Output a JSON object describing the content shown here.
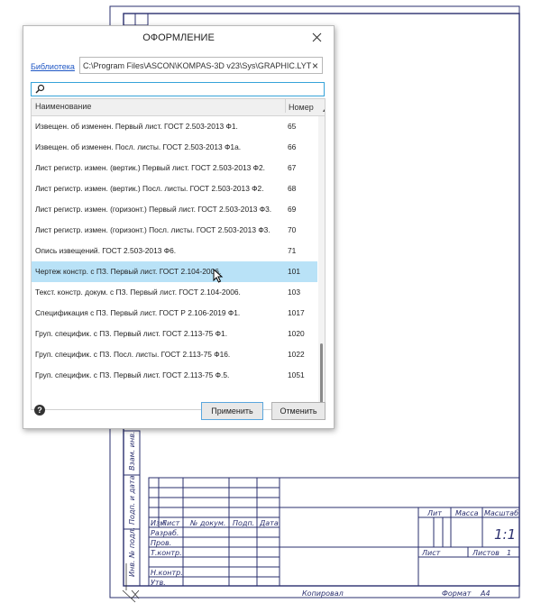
{
  "dialog": {
    "title": "ОФОРМЛЕНИЕ",
    "library_label": "Библиотека",
    "library_path": "C:\\Program Files\\ASCON\\KOMPAS-3D v23\\Sys\\GRAPHIC.LYT",
    "search_value": "",
    "columns": {
      "name": "Наименование",
      "number": "Номер"
    },
    "rows": [
      {
        "name": "Извещен. об изменен. Первый лист. ГОСТ 2.503-2013 Ф1.",
        "number": "65"
      },
      {
        "name": "Извещен. об изменен. Посл. листы. ГОСТ 2.503-2013 Ф1а.",
        "number": "66"
      },
      {
        "name": "Лист регистр. измен. (вертик.) Первый лист. ГОСТ 2.503-2013 Ф2.",
        "number": "67"
      },
      {
        "name": "Лист регистр. измен. (вертик.) Посл. листы. ГОСТ 2.503-2013 Ф2.",
        "number": "68"
      },
      {
        "name": "Лист регистр. измен. (горизонт.) Первый лист. ГОСТ 2.503-2013 Ф3.",
        "number": "69"
      },
      {
        "name": "Лист регистр. измен. (горизонт.) Посл. листы. ГОСТ 2.503-2013 Ф3.",
        "number": "70"
      },
      {
        "name": "Опись извещений. ГОСТ 2.503-2013 Ф6.",
        "number": "71"
      },
      {
        "name": "Чертеж констр. с ПЗ. Первый лист. ГОСТ 2.104-2006.",
        "number": "101",
        "selected": true
      },
      {
        "name": "Текст. констр. докум. с ПЗ. Первый лист. ГОСТ 2.104-2006.",
        "number": "103"
      },
      {
        "name": "Спецификация с ПЗ. Первый лист. ГОСТ Р 2.106-2019 Ф1.",
        "number": "1017"
      },
      {
        "name": "Груп. специфик. с ПЗ. Первый лист. ГОСТ 2.113-75 Ф1.",
        "number": "1020"
      },
      {
        "name": "Груп. специфик. с ПЗ. Посл. листы. ГОСТ 2.113-75 Ф16.",
        "number": "1022"
      },
      {
        "name": "Груп. специфик. с ПЗ. Первый лист. ГОСТ 2.113-75 Ф.5.",
        "number": "1051"
      }
    ],
    "apply_label": "Применить",
    "cancel_label": "Отменить"
  },
  "drawing": {
    "side_labels": {
      "inv_vzam": "Взам. инв.",
      "podp_data": "Подп. и дата",
      "inv_podl": "Инв. № подл."
    },
    "stamp_headers": {
      "izm": "Изм",
      "list": "Лист",
      "n_dokum": "№ докум.",
      "podp": "Подп.",
      "data": "Дата"
    },
    "stamp_roles": [
      "Разраб.",
      "Пров.",
      "Т.контр.",
      "Н.контр.",
      "Утв."
    ],
    "stamp_right": {
      "lit": "Лит",
      "massa": "Масса",
      "masshtab": "Масштаб",
      "scale_value": "1:1",
      "list": "Лист",
      "listov": "Листов",
      "listov_value": "1"
    },
    "bottom": {
      "kopiroval": "Копировал",
      "format": "Формат",
      "format_value": "А4"
    }
  },
  "colors": {
    "frame": "#2a2f6e",
    "selection": "#b9e2f7",
    "accent": "#36a3d9",
    "link": "#1f57c5"
  }
}
